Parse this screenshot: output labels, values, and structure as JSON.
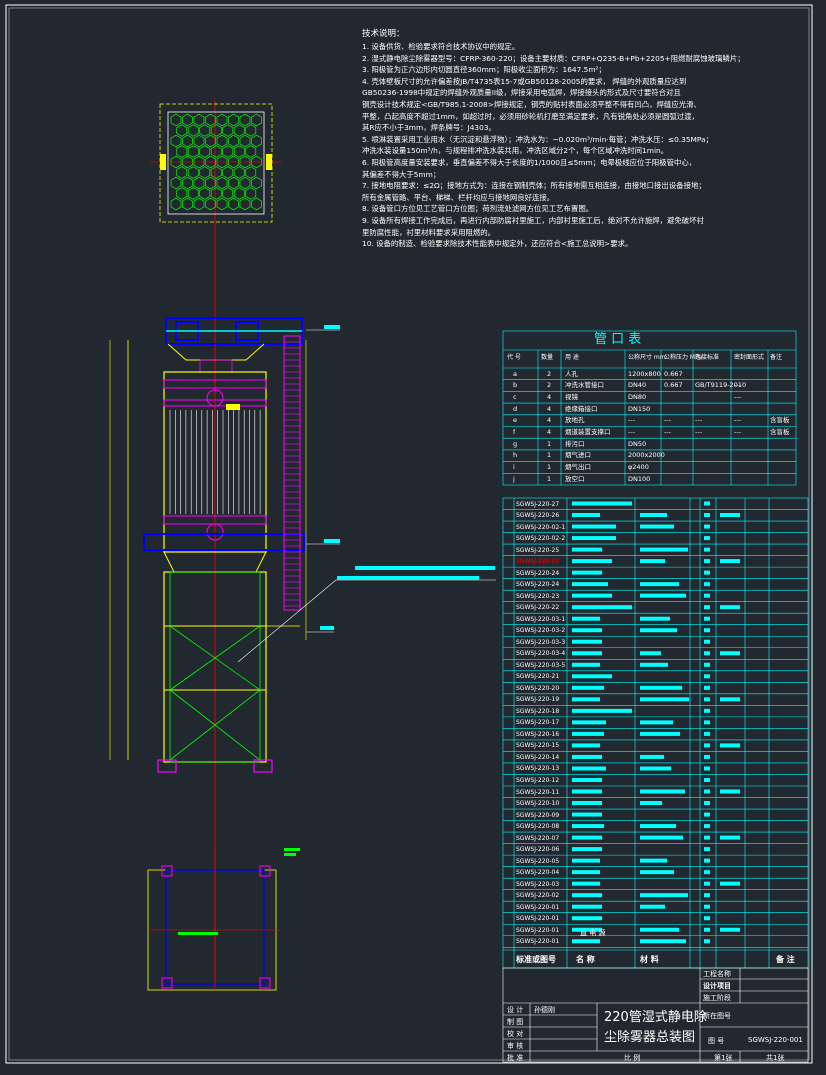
{
  "notes": {
    "title": "技术说明：",
    "lines": [
      "1.  设备供货、检验要求符合技术协议中的规定。",
      "2.  湿式静电除尘除雾器型号：CFRP-360-220；设备主要材质：CFRP+Q235-B+Pb+2205+阻燃耐腐蚀玻璃鳞片；",
      "3.  阳极管为正六边形内切圆直径360mm；阳极收尘面积为：1647.5m²；",
      "4.  壳体壁板尺寸的允许偏差按JB/T4735表15-7或GB50128-2005的要求，  焊缝的外观质量应达到",
      "    GB50236-1998中规定的焊缝外观质量II级，焊接采用电弧焊，焊接接头的形式及尺寸要符合对且",
      "    钢壳设计技术规定<GB/T985.1-2008>焊接规定，钢壳的贴衬表面必须平整不得有凹凸，焊缝应光滑、",
      "    平整，凸起高度不超过1mm，如超过时，必须用砂轮机打磨至满足要求，凡有锐角处必须是圆弧过渡，",
      "    其R应不小于3mm，焊条牌号：J4303。",
      "5.  喷淋装置采用工业用水（无沉淀和悬浮物）；冲洗水为：~0.020m³/min·每管；冲洗水压：≤0.35MPa；",
      "    冲洗水装设量150m³/h，与规程排冲洗水装共用，冲洗区域分2个，每个区域冲洗时间1min。",
      "6.  阳极管高度量安装要求，垂直偏差不得大于长度的1/1000且≤5mm；电晕极线应位于阳极管中心，",
      "    其偏差不得大于5mm；",
      "7.  接地电阻要求：≤2Ω；接地方式为：连接在钢制壳体；所有接地需互相连接，由接地口接出设备接地；",
      "    所有金属管路、平台、梯梯、栏杆均应与接地网良好连接。",
      "8.  设备管口方位见工艺管口方位图；荷剂流处滤网方位见工艺布置图。",
      "9.  设备所有焊接工作完成后，再进行内部防腐衬里施工，内部衬里施工后，绝对不允许施焊，避免破坏衬",
      "    里防腐性能，衬里材料要求采用阻燃的。",
      "10. 设备的制造、检验要求除技术性能表中规定外，还应符合<施工总说明>要求。"
    ]
  },
  "nozzle_table": {
    "title": "管  口  表",
    "headers": [
      "代 号",
      "数量",
      "用    途",
      "公称尺寸 mm",
      "公称压力 MPa",
      "连接标准",
      "密封面形式",
      "备注"
    ],
    "rows": [
      [
        "a",
        "2",
        "人孔",
        "1200x800",
        "0.667",
        "",
        "",
        ""
      ],
      [
        "b",
        "2",
        "冲洗水管接口",
        "DN40",
        "0.667",
        "GB/T9119-2010",
        "---",
        ""
      ],
      [
        "c",
        "4",
        "视镜",
        "DN80",
        "",
        "",
        "---",
        ""
      ],
      [
        "d",
        "4",
        "绝缘箱接口",
        "DN150",
        "",
        "",
        "",
        ""
      ],
      [
        "e",
        "4",
        "放地孔",
        "---",
        "---",
        "---",
        "---",
        "含盲板"
      ],
      [
        "f",
        "4",
        "烟道装置支撑口",
        "---",
        "---",
        "---",
        "---",
        "含盲板"
      ],
      [
        "g",
        "1",
        "排污口",
        "DN50",
        "",
        "",
        "",
        ""
      ],
      [
        "h",
        "1",
        "烟气进口",
        "2000x2000",
        "",
        "",
        "",
        ""
      ],
      [
        "i",
        "1",
        "烟气出口",
        "φ2400",
        "",
        "",
        "",
        ""
      ],
      [
        "j",
        "1",
        "放空口",
        "DN100",
        "",
        "",
        "",
        ""
      ]
    ]
  },
  "bom": {
    "highlight_row": 5,
    "rows": [
      "SGWSJ-220-27",
      "SGWSJ-220-26",
      "SGWSJ-220-02-1",
      "SGWSJ-220-02-2",
      "SGWSJ-220-25",
      "SGWSJ-220-03",
      "SGWSJ-220-24",
      "SGWSJ-220-24",
      "SGWSJ-220-23",
      "SGWSJ-220-22",
      "SGWSJ-220-03-1",
      "SGWSJ-220-03-2",
      "SGWSJ-220-03-3",
      "SGWSJ-220-03-4",
      "SGWSJ-220-03-5",
      "SGWSJ-220-21",
      "SGWSJ-220-20",
      "SGWSJ-220-19",
      "SGWSJ-220-18",
      "SGWSJ-220-17",
      "SGWSJ-220-16",
      "SGWSJ-220-15",
      "SGWSJ-220-14",
      "SGWSJ-220-13",
      "SGWSJ-220-12",
      "SGWSJ-220-11",
      "SGWSJ-220-10",
      "SGWSJ-220-09",
      "SGWSJ-220-08",
      "SGWSJ-220-07",
      "SGWSJ-220-06",
      "SGWSJ-220-05",
      "SGWSJ-220-04",
      "SGWSJ-220-03",
      "SGWSJ-220-02",
      "SGWSJ-220-01",
      "SGWSJ-220-01",
      "SGWSJ-220-01",
      "SGWSJ-220-01"
    ],
    "direct_label": "直 电 源",
    "header": [
      "标准或图号",
      "名    称",
      "材    料",
      "备    注"
    ]
  },
  "title_block": {
    "project_name": "工程名称",
    "design_project": "设计项目",
    "design_stage": "施工阶段",
    "roles": [
      "设 计",
      "制 图",
      "校 对",
      "审 核",
      "批 准"
    ],
    "designer": "孙德刚",
    "drawing_title_1": "220管湿式静电除",
    "drawing_title_2": "尘除雾器总装图",
    "scale_label": "比 例",
    "drawing_no_label": "图 号",
    "drawing_no": "SGWSJ-220-001",
    "sheet": "第1张",
    "sheets": "共1张",
    "location_label": "所在图号"
  },
  "colors": {
    "background": "#212830",
    "frame": "#ffffff",
    "table": "#00ffff",
    "structure": "#ffff00",
    "hex_plate": "#00ff00",
    "platform": "#0000ff",
    "accent": "#ff00ff",
    "centerline": "#ff0000"
  }
}
